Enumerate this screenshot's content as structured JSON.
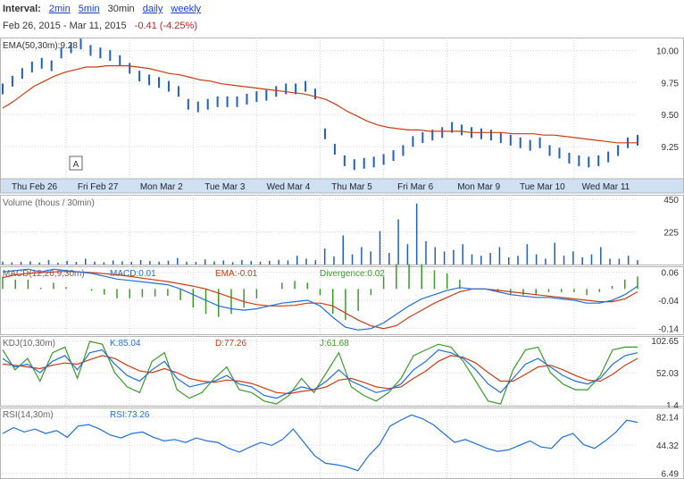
{
  "interval": {
    "label": "Interval:",
    "options": [
      {
        "label": "2min",
        "link": true
      },
      {
        "label": "5min",
        "link": true
      },
      {
        "label": "30min",
        "link": false
      },
      {
        "label": "daily",
        "link": true
      },
      {
        "label": "weekly",
        "link": true
      }
    ]
  },
  "range": {
    "dates": "Feb 26, 2015  -  Mar 11, 2015",
    "change": "-0.41 (-4.25%)"
  },
  "colors": {
    "price": "#1f5fbf",
    "ema": "#cc3b12",
    "macd": "#1f6fd8",
    "divergence": "#3a9a2a",
    "kdj_k": "#1f6fd8",
    "kdj_d": "#cc3b12",
    "kdj_j": "#3a9a2a",
    "rsi": "#1f6fd8",
    "grid": "#d6d6d6",
    "date_band": "#cfe0f3"
  },
  "chart_data": [
    {
      "type": "line",
      "panel": "price",
      "label": "EMA(50,30m):",
      "label_value": "9.28",
      "annotation": "A",
      "yticks": [
        "10.00",
        "9.75",
        "9.50",
        "9.25"
      ],
      "ylim": [
        9.0,
        10.1
      ],
      "x_dates": [
        "Thu Feb 26",
        "Fri Feb 27",
        "Mon Mar 2",
        "Tue Mar 3",
        "Wed Mar 4",
        "Thu Mar 5",
        "Fri Mar 6",
        "Mon Mar 9",
        "Tue Mar 10",
        "Wed Mar 11"
      ],
      "series": [
        {
          "values": [
            9.7,
            9.76,
            9.82,
            9.87,
            9.9,
            9.88,
            9.98,
            10.02,
            10.05,
            10.0,
            9.98,
            9.96,
            9.92,
            9.86,
            9.8,
            9.77,
            9.75,
            9.72,
            9.68,
            9.58,
            9.56,
            9.58,
            9.6,
            9.6,
            9.6,
            9.62,
            9.64,
            9.65,
            9.68,
            9.7,
            9.7,
            9.72,
            9.66,
            9.35,
            9.23,
            9.14,
            9.11,
            9.12,
            9.13,
            9.15,
            9.18,
            9.22,
            9.29,
            9.32,
            9.34,
            9.36,
            9.4,
            9.38,
            9.36,
            9.35,
            9.34,
            9.32,
            9.3,
            9.28,
            9.26,
            9.28,
            9.22,
            9.2,
            9.16,
            9.14,
            9.13,
            9.14,
            9.17,
            9.22,
            9.28,
            9.3
          ]
        },
        {
          "name": "EMA",
          "values": [
            9.55,
            9.6,
            9.66,
            9.72,
            9.76,
            9.8,
            9.83,
            9.85,
            9.87,
            9.87,
            9.88,
            9.88,
            9.88,
            9.87,
            9.86,
            9.84,
            9.82,
            9.81,
            9.79,
            9.77,
            9.76,
            9.74,
            9.73,
            9.72,
            9.71,
            9.7,
            9.69,
            9.68,
            9.67,
            9.66,
            9.64,
            9.62,
            9.58,
            9.53,
            9.49,
            9.45,
            9.42,
            9.4,
            9.39,
            9.38,
            9.38,
            9.37,
            9.37,
            9.37,
            9.37,
            9.36,
            9.36,
            9.36,
            9.36,
            9.35,
            9.35,
            9.35,
            9.34,
            9.34,
            9.33,
            9.32,
            9.31,
            9.3,
            9.29,
            9.28,
            9.28,
            9.28
          ]
        }
      ]
    },
    {
      "type": "bar",
      "panel": "volume",
      "label": "Volume (thous / 30min)",
      "yticks": [
        "450",
        "225"
      ],
      "ylim": [
        0,
        480
      ],
      "values": [
        20,
        15,
        18,
        22,
        14,
        30,
        12,
        25,
        18,
        40,
        20,
        16,
        28,
        22,
        18,
        30,
        24,
        20,
        26,
        45,
        20,
        18,
        35,
        22,
        28,
        16,
        30,
        24,
        20,
        26,
        32,
        28,
        60,
        40,
        30,
        110,
        55,
        200,
        70,
        120,
        90,
        230,
        80,
        310,
        140,
        420,
        160,
        120,
        90,
        100,
        140,
        70,
        60,
        80,
        120,
        50,
        60,
        140,
        70,
        40,
        150,
        60,
        90,
        50,
        70,
        120,
        40,
        40,
        60,
        30
      ]
    },
    {
      "type": "line",
      "panel": "macd",
      "label": "MACD(12,26,9,30m)",
      "macd_label": "MACD:0.01",
      "ema_label": "EMA:-0.01",
      "divergence_label": "Divergence:0.02",
      "yticks": [
        "0.06",
        "-0.04",
        "-0.14"
      ],
      "ylim": [
        -0.16,
        0.08
      ],
      "series": [
        {
          "name": "MACD",
          "values": [
            0.06,
            0.065,
            0.07,
            0.06,
            0.07,
            0.065,
            0.06,
            0.055,
            0.045,
            0.035,
            0.03,
            0.025,
            0.02,
            0.015,
            0.0,
            -0.02,
            -0.04,
            -0.06,
            -0.07,
            -0.075,
            -0.07,
            -0.06,
            -0.05,
            -0.045,
            -0.04,
            -0.06,
            -0.1,
            -0.135,
            -0.145,
            -0.14,
            -0.12,
            -0.09,
            -0.06,
            -0.035,
            -0.02,
            -0.005,
            0.005,
            0.0,
            0.0,
            -0.01,
            -0.02,
            -0.025,
            -0.03,
            -0.03,
            -0.035,
            -0.04,
            -0.05,
            -0.05,
            -0.04,
            -0.02,
            0.01
          ]
        },
        {
          "name": "EMA",
          "values": [
            0.04,
            0.05,
            0.055,
            0.058,
            0.06,
            0.062,
            0.06,
            0.058,
            0.054,
            0.05,
            0.045,
            0.038,
            0.032,
            0.026,
            0.018,
            0.01,
            0.0,
            -0.015,
            -0.03,
            -0.045,
            -0.055,
            -0.06,
            -0.06,
            -0.058,
            -0.05,
            -0.05,
            -0.06,
            -0.085,
            -0.11,
            -0.13,
            -0.14,
            -0.13,
            -0.1,
            -0.075,
            -0.05,
            -0.03,
            -0.01,
            0.0,
            0.0,
            -0.005,
            -0.01,
            -0.015,
            -0.02,
            -0.025,
            -0.03,
            -0.035,
            -0.04,
            -0.045,
            -0.045,
            -0.035,
            -0.01
          ]
        },
        {
          "name": "Divergence",
          "values": [
            0.02,
            0.015,
            0.015,
            0.002,
            0.01,
            0.003,
            0.0,
            -0.003,
            -0.009,
            -0.015,
            -0.015,
            -0.013,
            -0.012,
            -0.011,
            -0.018,
            -0.03,
            -0.04,
            -0.045,
            -0.04,
            -0.03,
            -0.015,
            0.0,
            0.01,
            0.013,
            0.01,
            -0.01,
            -0.04,
            -0.05,
            -0.035,
            -0.01,
            0.02,
            0.04,
            0.04,
            0.04,
            0.03,
            0.025,
            0.015,
            0.0,
            0.0,
            -0.005,
            -0.01,
            -0.01,
            -0.01,
            -0.005,
            -0.005,
            -0.005,
            -0.01,
            -0.005,
            0.005,
            0.015,
            0.02
          ]
        }
      ]
    },
    {
      "type": "line",
      "panel": "kdj",
      "label": "KDJ(10,30m)",
      "k_label": "K:85.04",
      "d_label": "D:77.26",
      "j_label": "J:61.68",
      "yticks": [
        "102.65",
        "52.03",
        "1.4"
      ],
      "ylim": [
        0,
        110
      ],
      "series": [
        {
          "name": "K",
          "values": [
            80,
            65,
            70,
            55,
            75,
            85,
            60,
            90,
            95,
            70,
            50,
            40,
            60,
            75,
            45,
            30,
            35,
            40,
            50,
            35,
            30,
            15,
            10,
            20,
            30,
            25,
            40,
            60,
            40,
            30,
            20,
            25,
            35,
            60,
            75,
            95,
            90,
            80,
            60,
            35,
            20,
            45,
            70,
            80,
            65,
            50,
            40,
            35,
            45,
            70,
            85,
            90
          ]
        },
        {
          "name": "D",
          "values": [
            70,
            68,
            65,
            62,
            68,
            72,
            70,
            78,
            85,
            80,
            68,
            58,
            55,
            62,
            55,
            45,
            40,
            38,
            42,
            40,
            36,
            28,
            20,
            18,
            22,
            25,
            30,
            42,
            45,
            38,
            30,
            27,
            30,
            45,
            58,
            75,
            85,
            82,
            72,
            55,
            40,
            40,
            52,
            65,
            68,
            60,
            50,
            42,
            40,
            52,
            68,
            80
          ]
        },
        {
          "name": "J",
          "values": [
            95,
            60,
            80,
            40,
            90,
            100,
            45,
            110,
            105,
            55,
            30,
            20,
            75,
            90,
            25,
            10,
            20,
            45,
            65,
            25,
            20,
            5,
            0,
            15,
            45,
            20,
            55,
            90,
            30,
            15,
            5,
            20,
            45,
            85,
            95,
            105,
            100,
            75,
            40,
            5,
            0,
            60,
            95,
            100,
            55,
            35,
            25,
            25,
            50,
            95,
            100,
            100
          ]
        }
      ]
    },
    {
      "type": "line",
      "panel": "rsi",
      "label": "RSI(14,30m)",
      "rsi_label": "RSI:73.26",
      "yticks": [
        "82.14",
        "44.32",
        "6.49"
      ],
      "ylim": [
        0,
        95
      ],
      "series": [
        {
          "name": "RSI",
          "values": [
            60,
            68,
            62,
            66,
            60,
            64,
            55,
            70,
            72,
            66,
            58,
            54,
            60,
            62,
            55,
            50,
            52,
            48,
            54,
            50,
            48,
            40,
            35,
            42,
            48,
            44,
            52,
            66,
            48,
            30,
            20,
            18,
            15,
            10,
            30,
            45,
            70,
            78,
            85,
            80,
            72,
            60,
            48,
            52,
            46,
            40,
            36,
            38,
            44,
            50,
            42,
            40,
            55,
            60,
            45,
            40,
            50,
            62,
            78,
            75
          ]
        }
      ]
    }
  ]
}
